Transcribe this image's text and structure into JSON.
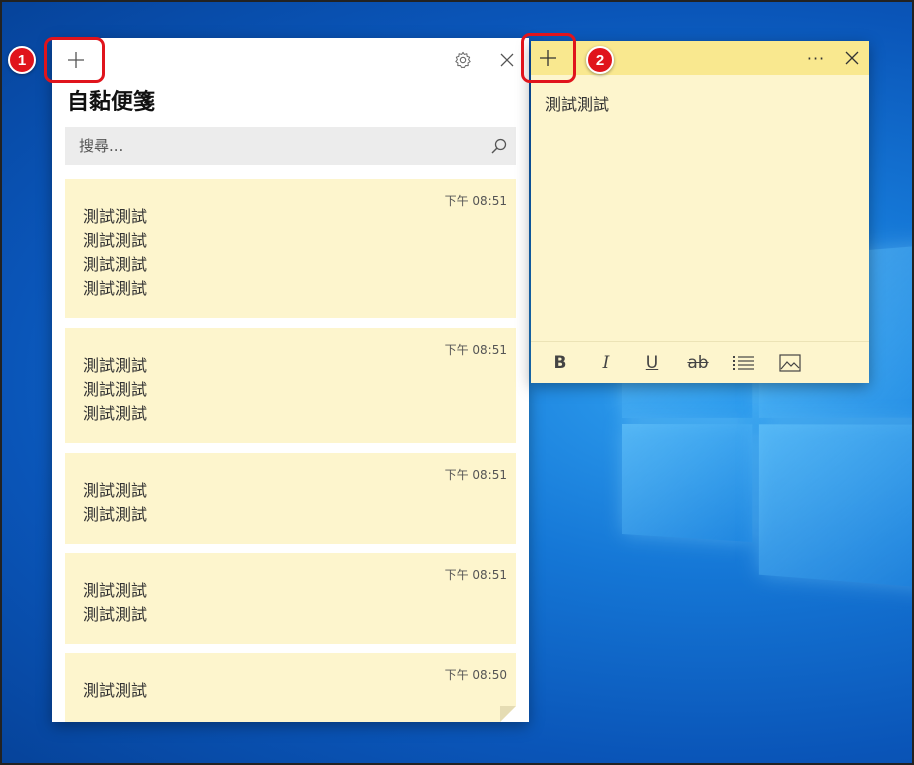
{
  "colors": {
    "note_yellow": "#fdf5cd",
    "note_header": "#f9e88f",
    "annotation_red": "#e0141c"
  },
  "list_window": {
    "title": "自黏便箋",
    "search_placeholder": "搜尋...",
    "icons": {
      "add": "plus-icon",
      "settings": "gear-icon",
      "close": "close-icon",
      "search": "search-icon"
    },
    "notes": [
      {
        "time": "下午 08:51",
        "lines": [
          "測試測試",
          "測試測試",
          "測試測試",
          "測試測試"
        ]
      },
      {
        "time": "下午 08:51",
        "lines": [
          "測試測試",
          "測試測試",
          "測試測試"
        ]
      },
      {
        "time": "下午 08:51",
        "lines": [
          "測試測試",
          "測試測試"
        ]
      },
      {
        "time": "下午 08:51",
        "lines": [
          "測試測試",
          "測試測試"
        ]
      },
      {
        "time": "下午 08:50",
        "lines": [
          "測試測試"
        ]
      }
    ]
  },
  "note_window": {
    "content": "測試測試",
    "more_label": "···",
    "icons": {
      "add": "plus-icon",
      "more": "more-icon",
      "close": "close-icon"
    },
    "toolbar": {
      "bold": "B",
      "italic": "I",
      "underline": "U",
      "strikethrough": "ab",
      "bullets_icon": "bullet-list-icon",
      "image_icon": "image-icon"
    }
  },
  "annotations": {
    "badge1": "1",
    "badge2": "2"
  }
}
